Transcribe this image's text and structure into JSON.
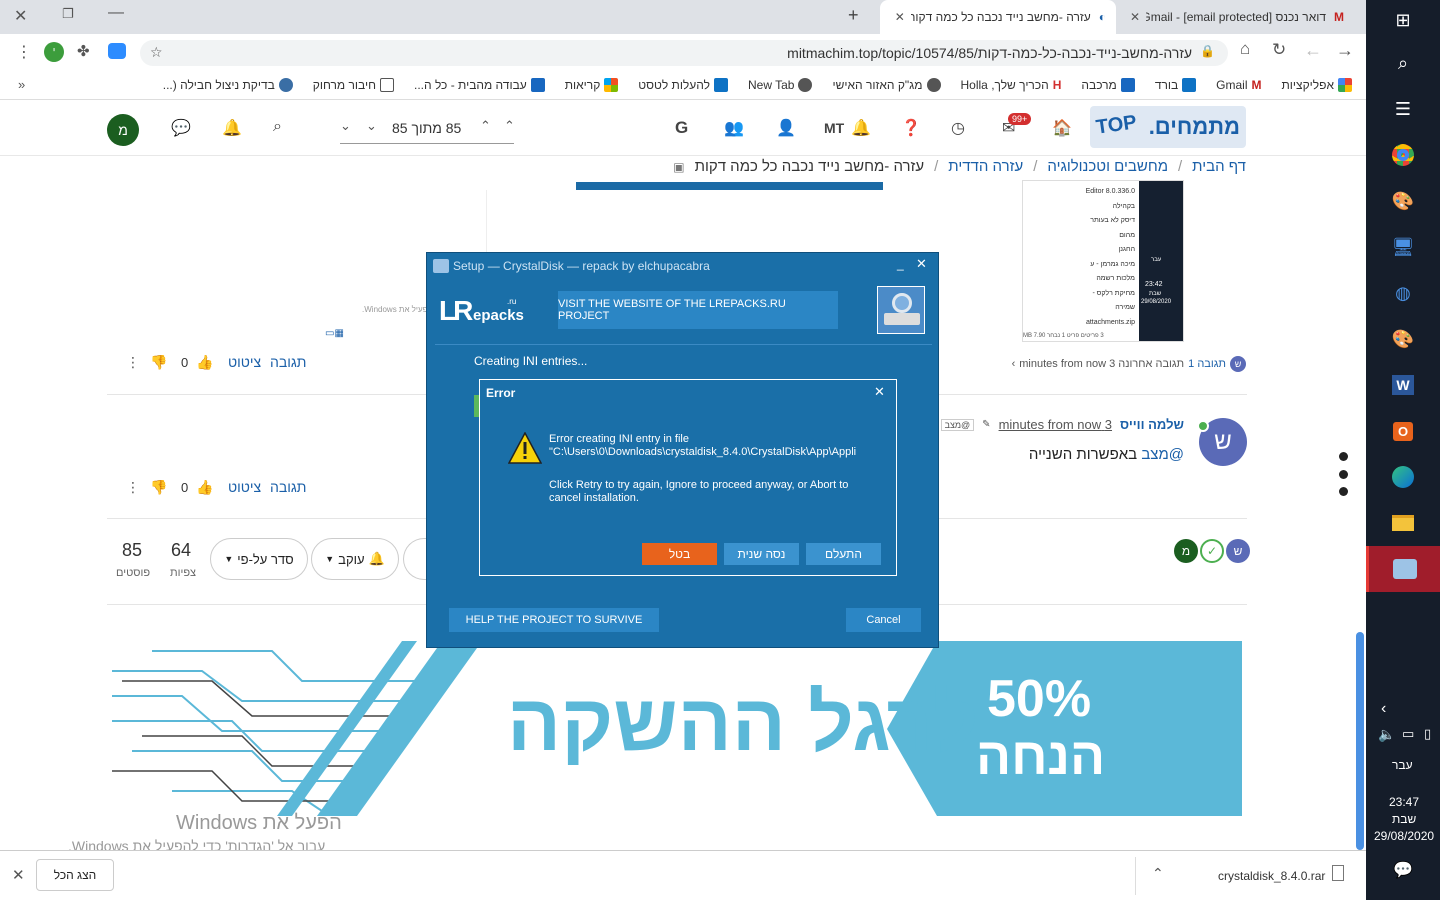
{
  "browser": {
    "tabs": [
      {
        "title": "דואר נכנס Gmail - [email protected]"
      },
      {
        "title": "עזרה -מחשב נייד נכבה כל כמה דקות"
      }
    ],
    "url": "mitmachim.top/topic/10574/85/עזרה-מחשב-נייד-נכבה-כל-כמה-דקות",
    "bookmarks": [
      "אפליקציות",
      "Gmail",
      "בורד",
      "מרכבה",
      "הכריך שלך, Holla",
      "מג\"ק האזור האישי",
      "New Tab",
      "להעלות לטסט",
      "קריאות",
      "עבודה מהבית - כל ה...",
      "חיבור מרחוק",
      "בדיקת ניצול חבילה (..."
    ],
    "more": "»"
  },
  "forum": {
    "logo": "מתמחים.",
    "logo_top": "TOP",
    "badge": "99+",
    "user_initials": "MT",
    "page_counter": "85 מתוך 85",
    "avatar_letter": "מ",
    "breadcrumb": [
      "דף הבית",
      "מחשבים וטכנולוגיה",
      "עזרה הדדית",
      "עזרה -מחשב נייד נכבה כל כמה דקות"
    ],
    "thumb": {
      "files": [
        "Editor 8.0.336.0",
        "בקהילה",
        "דיסק לא בעותר",
        "מהום",
        "החגנן",
        "מיכה גמרמן - ע",
        "מלכות רשמה",
        "מחיקת רלקס -",
        "שמירה",
        "attachments.zip"
      ],
      "status": "3 פריטים   פריט 1 נבחר  7.90 MB",
      "time": "23:42",
      "day": "שבת",
      "date": "29/08/2020",
      "lang": "עבר"
    },
    "watermark_small": "עבור אל 'הגדרות' כדי להפעיל את Windows.",
    "post1": {
      "reply": "תגובה",
      "quote": "ציטוט",
      "votes": "0",
      "last_reply_prefix": "תגובה 1",
      "last_reply": "תגובה אחרונה 3 minutes from now"
    },
    "post2": {
      "avatar_letter": "ש",
      "author": "שלמה ווייס",
      "time": "3 minutes from now",
      "quote_tag": "@מצב",
      "mention": "@מצב",
      "body": "באפשרות השנייה",
      "reply": "תגובה",
      "quote": "ציטוט",
      "votes": "0"
    },
    "stats": {
      "posts_count": "85",
      "posts_label": "פוסטים",
      "views_count": "64",
      "views_label": "צפיות",
      "sort": "סדר על-פי",
      "follow": "עוקב"
    },
    "participants": [
      "ש",
      "מ"
    ],
    "banner": {
      "headline": "לרגל ההשקה",
      "percent": "50%",
      "discount": "הנחה"
    },
    "win_watermark_title": "הפעל את Windows",
    "win_watermark_sub": "עבור אל 'הגדרות' כדי להפעיל את Windows."
  },
  "setup": {
    "title": "Setup — CrystalDisk — repack by elchupacabra",
    "logo_lr": "LR",
    "logo_repacks": "epacks",
    "logo_ru": ".ru",
    "visit": "VISIT THE WEBSITE OF THE LREPACKS.RU PROJECT",
    "status": "Creating INI entries...",
    "help": "HELP THE PROJECT TO SURVIVE",
    "cancel": "Cancel"
  },
  "error": {
    "title": "Error",
    "line1": "Error creating INI entry in file",
    "line2": "\"C:\\Users\\0\\Downloads\\crystaldisk_8.4.0\\CrystalDisk\\App\\Appli",
    "line3": "Click Retry to try again, Ignore to proceed anyway, or Abort to cancel installation.",
    "btn_abort": "בטל",
    "btn_retry": "נסה שנית",
    "btn_ignore": "התעלם"
  },
  "downloads": {
    "file": "crystaldisk_8.4.0.rar",
    "show_all": "הצג הכל"
  },
  "taskbar": {
    "lang": "עבר",
    "time": "23:47",
    "day": "שבת",
    "date": "29/08/2020"
  },
  "colors": {
    "setup_bg": "#1a6fa8",
    "abort_btn": "#e8631c",
    "forum_blue": "#1a5fa8"
  }
}
